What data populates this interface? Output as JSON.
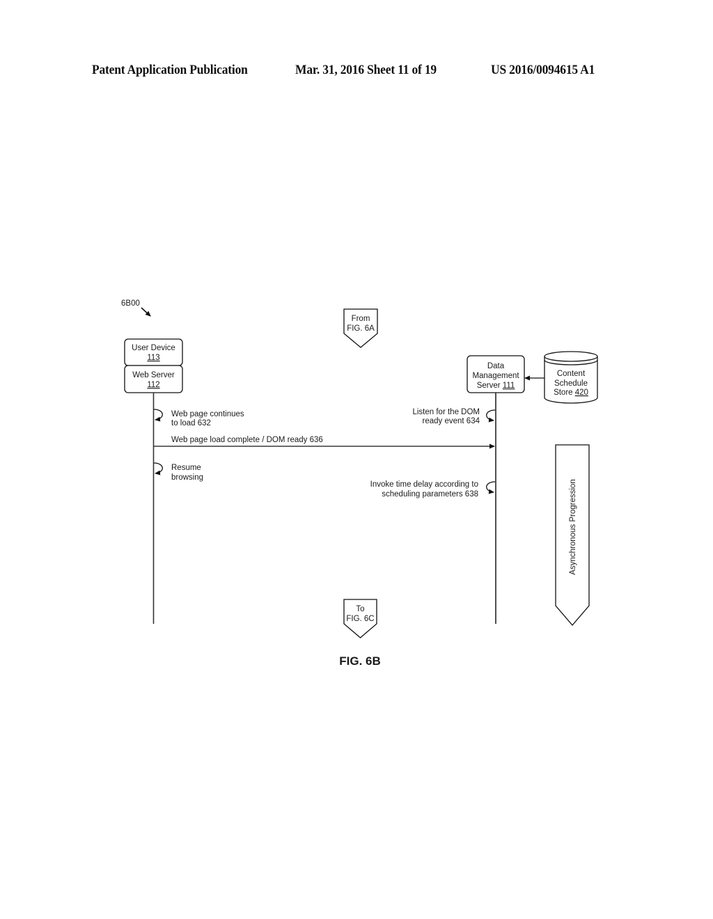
{
  "header": {
    "publication": "Patent Application Publication",
    "date_sheet": "Mar. 31, 2016  Sheet 11 of 19",
    "number": "US 2016/0094615 A1"
  },
  "diagram": {
    "ref_label": "6B00",
    "from_connector": {
      "line1": "From",
      "line2": "FIG. 6A"
    },
    "to_connector": {
      "line1": "To",
      "line2": "FIG. 6C"
    },
    "actors": {
      "user_device": {
        "name": "User Device",
        "ref": "113"
      },
      "web_server": {
        "name": "Web Server",
        "ref": "112"
      },
      "data_mgmt": {
        "line1": "Data",
        "line2": "Management",
        "line3_prefix": "Server ",
        "ref": "111"
      },
      "store": {
        "line1": "Content",
        "line2": "Schedule",
        "line3_prefix": "Store ",
        "ref": "420"
      }
    },
    "steps": {
      "s632": {
        "line1": "Web page continues",
        "line2": "to load 632"
      },
      "s634": {
        "line1": "Listen for the DOM",
        "line2": "ready event 634"
      },
      "s636": {
        "line1": "Web page load complete / DOM ready 636"
      },
      "resume": {
        "line1": "Resume",
        "line2": "browsing"
      },
      "s638": {
        "line1": "Invoke time delay according to",
        "line2": "scheduling parameters 638"
      }
    },
    "progression_label": "Asynchronous Progression",
    "caption": "FIG. 6B"
  }
}
